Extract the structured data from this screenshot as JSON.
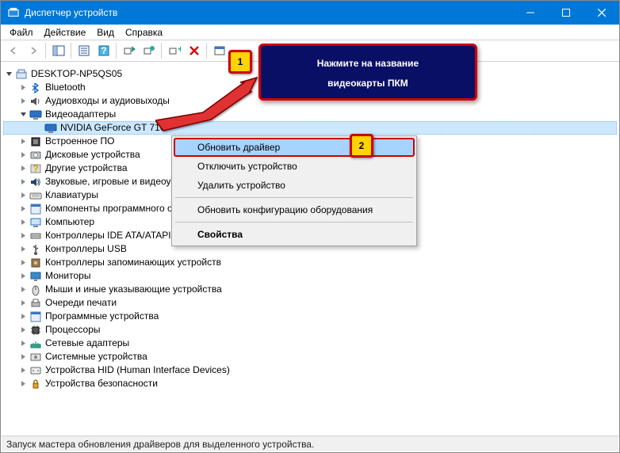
{
  "window": {
    "title": "Диспетчер устройств"
  },
  "menu": [
    "Файл",
    "Действие",
    "Вид",
    "Справка"
  ],
  "callout": "Нажмите на название\nвидеокарты ПКМ",
  "badges": {
    "one": "1",
    "two": "2"
  },
  "tree": {
    "root": "DESKTOP-NP5QS05",
    "items": [
      {
        "label": "Bluetooth",
        "icon": "bluetooth"
      },
      {
        "label": "Аудиовходы и аудиовыходы",
        "icon": "audio"
      },
      {
        "label": "Видеоадаптеры",
        "icon": "display",
        "expanded": true,
        "children": [
          {
            "label": "NVIDIA GeForce GT 710",
            "icon": "display",
            "selected": true
          }
        ]
      },
      {
        "label": "Встроенное ПО",
        "icon": "firmware"
      },
      {
        "label": "Дисковые устройства",
        "icon": "disk"
      },
      {
        "label": "Другие устройства",
        "icon": "unknown"
      },
      {
        "label": "Звуковые, игровые и видеоустройства",
        "icon": "sound"
      },
      {
        "label": "Клавиатуры",
        "icon": "keyboard"
      },
      {
        "label": "Компоненты программного обеспечения",
        "icon": "software"
      },
      {
        "label": "Компьютер",
        "icon": "computer"
      },
      {
        "label": "Контроллеры IDE ATA/ATAPI",
        "icon": "ide"
      },
      {
        "label": "Контроллеры USB",
        "icon": "usb"
      },
      {
        "label": "Контроллеры запоминающих устройств",
        "icon": "storage"
      },
      {
        "label": "Мониторы",
        "icon": "monitor"
      },
      {
        "label": "Мыши и иные указывающие устройства",
        "icon": "mouse"
      },
      {
        "label": "Очереди печати",
        "icon": "printer"
      },
      {
        "label": "Программные устройства",
        "icon": "software"
      },
      {
        "label": "Процессоры",
        "icon": "cpu"
      },
      {
        "label": "Сетевые адаптеры",
        "icon": "network"
      },
      {
        "label": "Системные устройства",
        "icon": "system"
      },
      {
        "label": "Устройства HID (Human Interface Devices)",
        "icon": "hid"
      },
      {
        "label": "Устройства безопасности",
        "icon": "security"
      }
    ]
  },
  "ctx": {
    "items": [
      {
        "label": "Обновить драйвер",
        "hl": true
      },
      {
        "label": "Отключить устройство"
      },
      {
        "label": "Удалить устройство"
      },
      {
        "sep": true
      },
      {
        "label": "Обновить конфигурацию оборудования"
      },
      {
        "sep": true
      },
      {
        "label": "Свойства",
        "bold": true
      }
    ]
  },
  "status": "Запуск мастера обновления драйверов для выделенного устройства.",
  "colors": {
    "accent": "#0078d7",
    "callout_bg": "#0a0f66",
    "badge_bg": "#ffd400",
    "hl_border": "#c00"
  }
}
